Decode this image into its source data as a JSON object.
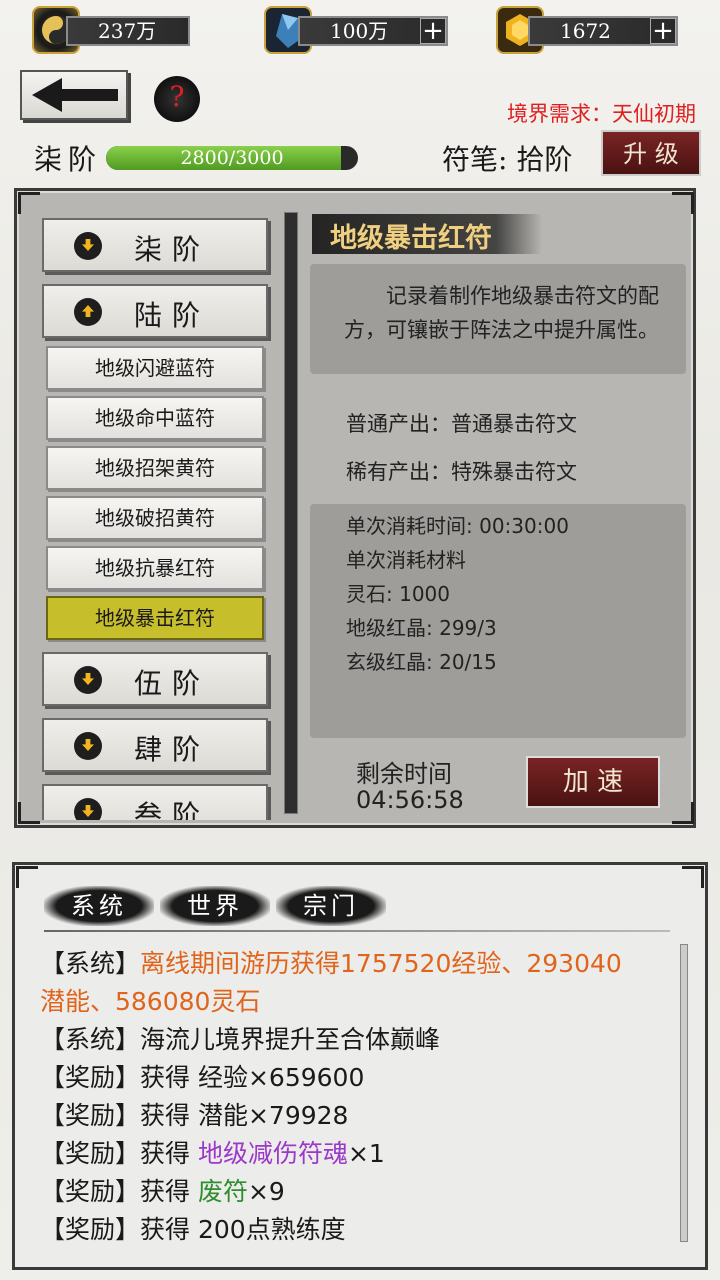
{
  "resources": {
    "taiji_value": "237万",
    "crystal_value": "100万",
    "gold_value": "1672",
    "plus": "+"
  },
  "header": {
    "back_icon": "arrow-left-icon",
    "help_icon": "question-icon",
    "help_text": "?",
    "realm_req": "境界需求：天仙初期",
    "stage_label": "柒阶",
    "exp_text": "2800/3000",
    "exp_progress": 0.9333,
    "pen_label": "符笔: 拾阶",
    "upgrade_label": "升 级"
  },
  "list": {
    "items": [
      {
        "label": "柒阶",
        "icon": "chevron-down-icon"
      },
      {
        "label": "陆阶",
        "icon": "chevron-up-icon"
      },
      {
        "label": "伍阶",
        "icon": "chevron-down-icon"
      },
      {
        "label": "肆阶",
        "icon": "chevron-down-icon"
      },
      {
        "label": "叁阶",
        "icon": "chevron-down-icon"
      }
    ],
    "sub_items": [
      "地级闪避蓝符",
      "地级命中蓝符",
      "地级招架黄符",
      "地级破招黄符",
      "地级抗暴红符",
      "地级暴击红符"
    ]
  },
  "detail": {
    "title": "地级暴击红符",
    "desc_line1": "记录着制作地级暴击符文的配",
    "desc_line2": "方，可镶嵌于阵法之中提升属性。",
    "normal_output": "普通产出：普通暴击符文",
    "rare_output": "稀有产出：特殊暴击符文",
    "time_cost": "单次消耗时间: 00:30:00",
    "material_title": "单次消耗材料",
    "mat1": "灵石: 1000",
    "mat2": "地级红晶: 299/3",
    "mat3": "玄级红晶: 20/15",
    "remain_label": "剩余时间",
    "remain_time": "04:56:58",
    "speed_label": "加 速"
  },
  "chat": {
    "tabs": [
      "系统",
      "世界",
      "宗门"
    ],
    "l1_tag": "【系统】",
    "l1_text": "离线期间游历获得1757520经验、293040",
    "l1_cont": "潜能、586080灵石",
    "l2_tag": "【系统】",
    "l2_text": "海流儿境界提升至合体巅峰",
    "l3_tag": "【奖励】",
    "l3_text": "获得 经验×659600",
    "l4_tag": "【奖励】",
    "l4_text": "获得 潜能×79928",
    "l5_tag": "【奖励】",
    "l5_pre": "获得 ",
    "l5_item": "地级减伤符魂",
    "l5_post": "×1",
    "l6_tag": "【奖励】",
    "l6_pre": "获得 ",
    "l6_item": "废符",
    "l6_post": "×9",
    "l7_tag": "【奖励】",
    "l7_text": "获得 200点熟练度"
  }
}
